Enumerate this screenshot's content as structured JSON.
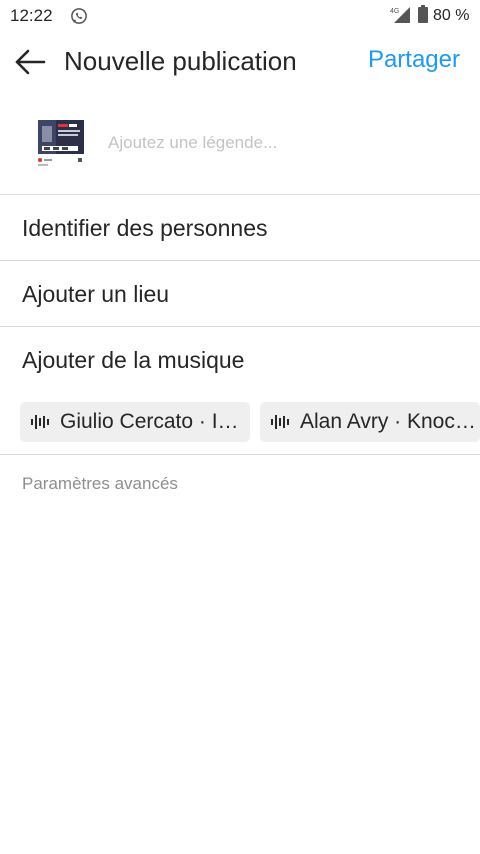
{
  "status_bar": {
    "time": "12:22",
    "network": "4G",
    "battery_percent": "80 %"
  },
  "header": {
    "back_icon": "arrow-left-icon",
    "title": "Nouvelle publication",
    "share_label": "Partager"
  },
  "caption": {
    "placeholder": "Ajoutez une légende...",
    "value": ""
  },
  "menu": {
    "tag_people": "Identifier des personnes",
    "add_location": "Ajouter un lieu",
    "add_music": "Ajouter de la musique"
  },
  "music_suggestions": [
    {
      "label": "Giulio Cercato · I…"
    },
    {
      "label": "Alan Avry · Knoc…"
    }
  ],
  "advanced_settings": "Paramètres avancés",
  "colors": {
    "accent": "#1d9bf0",
    "text": "#262626",
    "placeholder": "#c4c4c4",
    "secondary": "#8e8e8e",
    "divider": "#dbdbdb",
    "chip_bg": "#efefef"
  }
}
